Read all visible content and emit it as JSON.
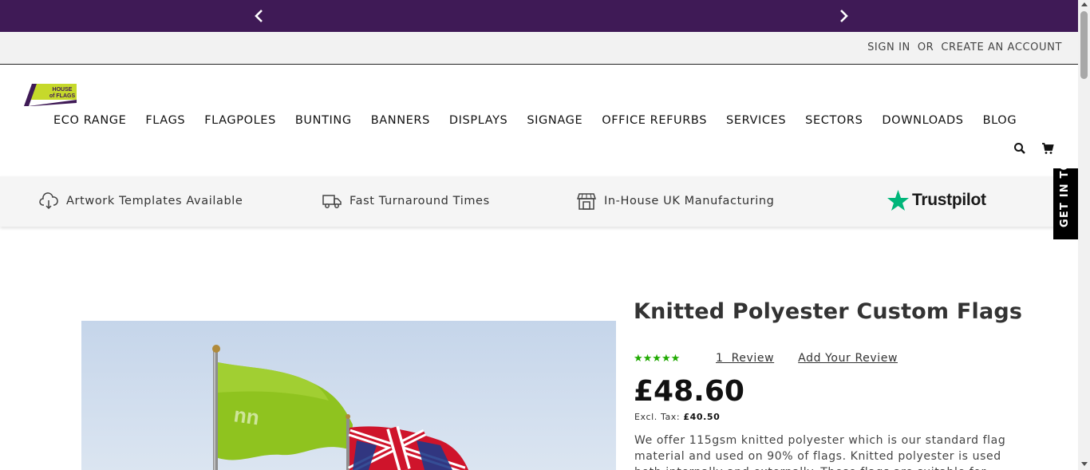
{
  "promo": {
    "prev_icon": "chevron-left-icon",
    "next_icon": "chevron-right-icon",
    "background": "#3f1a56"
  },
  "account": {
    "sign_in": "SIGN IN",
    "or": "OR",
    "create_account": "CREATE AN ACCOUNT"
  },
  "header": {
    "logo": {
      "line1": "HOUSE",
      "line2": "of FLAGS",
      "color": "#c6d92b"
    },
    "nav": [
      "ECO RANGE",
      "FLAGS",
      "FLAGPOLES",
      "BUNTING",
      "BANNERS",
      "DISPLAYS",
      "SIGNAGE",
      "OFFICE REFURBS",
      "SERVICES",
      "SECTORS",
      "DOWNLOADS",
      "BLOG"
    ],
    "search_icon": "search-icon",
    "cart_icon": "cart-icon"
  },
  "usps": [
    {
      "icon": "cloud-download-icon",
      "label": "Artwork Templates Available"
    },
    {
      "icon": "delivery-truck-icon",
      "label": "Fast Turnaround Times"
    },
    {
      "icon": "shop-front-icon",
      "label": "In-House UK Manufacturing"
    }
  ],
  "trustpilot": {
    "label": "Trustpilot",
    "star_color": "#00b67a"
  },
  "side_tab": {
    "label": "GET IN TO"
  },
  "product": {
    "title": "Knitted Polyester Custom Flags",
    "rating": {
      "stars": "★★★★★",
      "star_color": "#1faa00",
      "reviews_label": "1  Review",
      "add_review_label": "Add Your Review"
    },
    "price": "£48.60",
    "excl_tax_label": "Excl. Tax:",
    "excl_tax_value": "£40.50",
    "description": "We offer 115gsm knitted polyester which is our standard flag material and used on 90% of flags. Knitted polyester is used both internally and externally. These flags are suitable for"
  }
}
